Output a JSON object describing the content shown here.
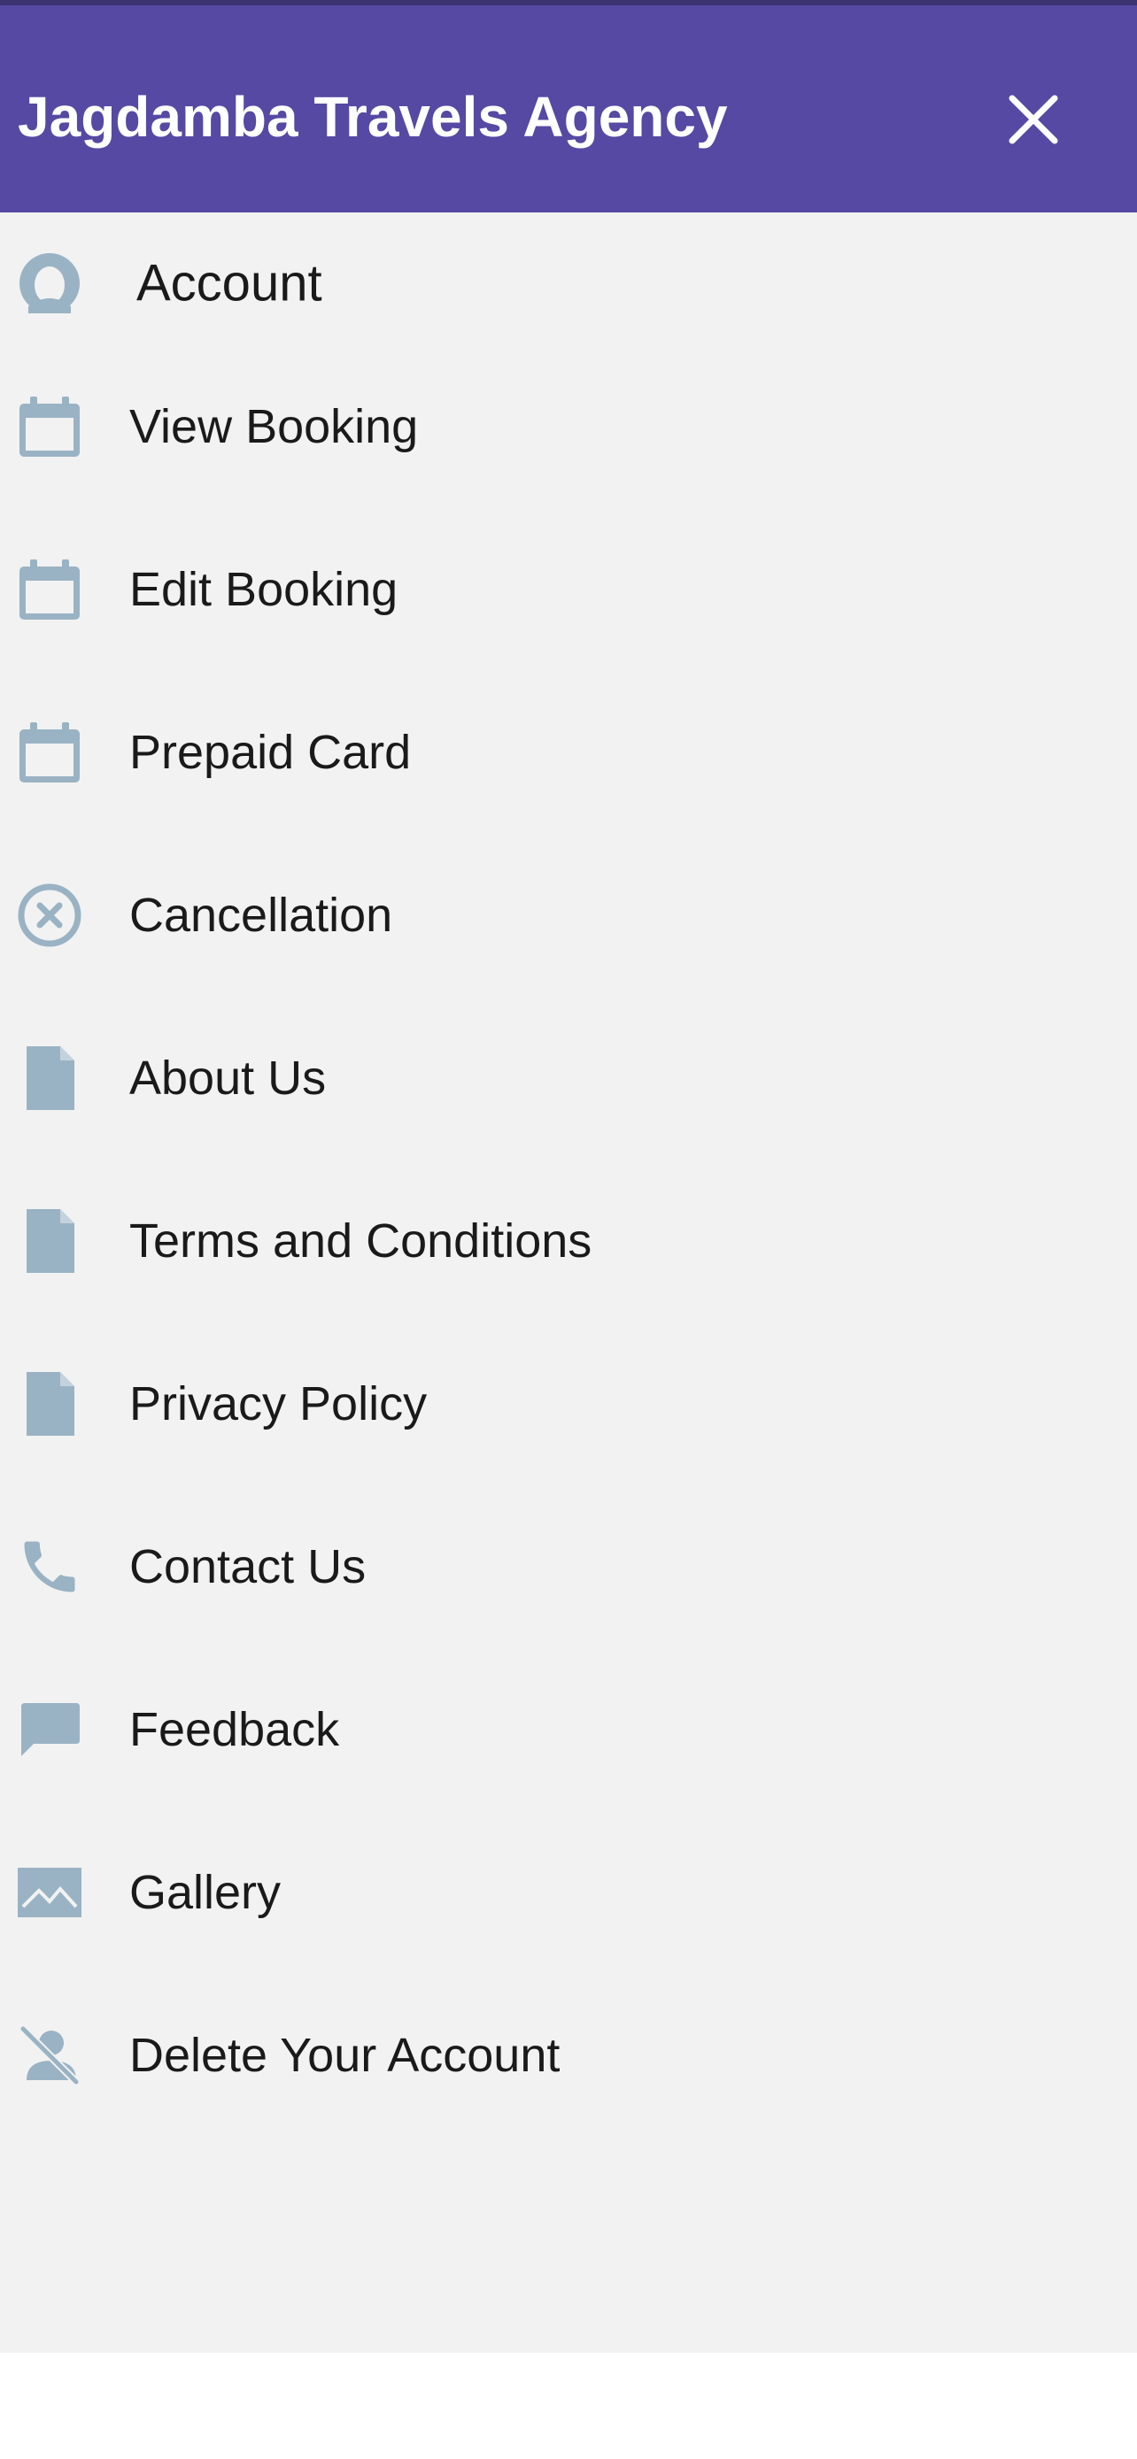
{
  "header": {
    "title": "Jagdamba Travels Agency",
    "close_icon": "close-icon",
    "background_color": "#5549a3"
  },
  "menu": {
    "icon_color": "#9ab3c4",
    "items": [
      {
        "label": "Account",
        "icon": "account-icon"
      },
      {
        "label": "View Booking",
        "icon": "calendar-icon"
      },
      {
        "label": "Edit Booking",
        "icon": "calendar-icon"
      },
      {
        "label": "Prepaid Card",
        "icon": "calendar-icon"
      },
      {
        "label": "Cancellation",
        "icon": "cancel-circle-icon"
      },
      {
        "label": "About Us",
        "icon": "document-icon"
      },
      {
        "label": "Terms and Conditions",
        "icon": "document-icon"
      },
      {
        "label": "Privacy Policy",
        "icon": "document-icon"
      },
      {
        "label": "Contact Us",
        "icon": "phone-icon"
      },
      {
        "label": "Feedback",
        "icon": "chat-bubble-icon"
      },
      {
        "label": "Gallery",
        "icon": "image-icon"
      },
      {
        "label": "Delete Your Account",
        "icon": "person-off-icon"
      }
    ]
  }
}
